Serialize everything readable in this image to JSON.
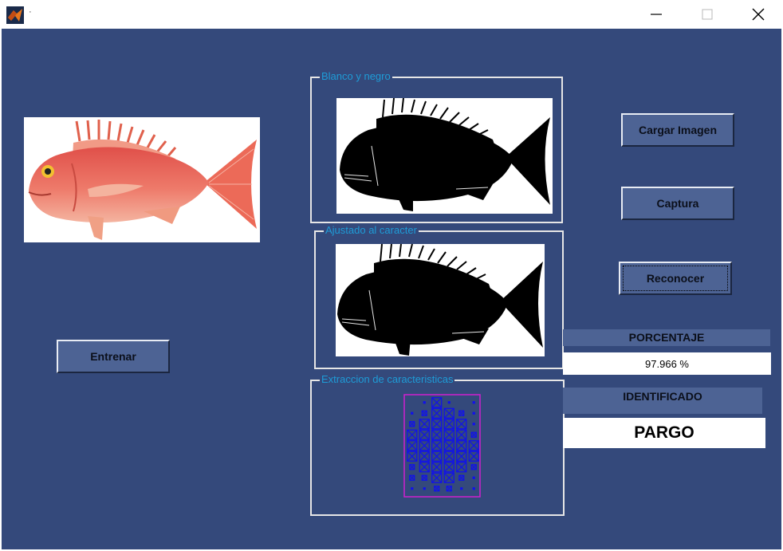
{
  "window": {
    "title": "·",
    "minimize_icon": "minimize-icon",
    "maximize_icon": "maximize-icon",
    "close_icon": "close-icon"
  },
  "colors": {
    "background": "#34497b",
    "button": "#4d6394",
    "frame_title": "#1e9cd7",
    "feature_grid": "#1010ee",
    "feature_border": "#d020d0"
  },
  "panels": {
    "bw_title": "Blanco y negro",
    "adjusted_title": "Ajustado al caracter",
    "features_title": "Extraccion de caracteristicas"
  },
  "buttons": {
    "load": "Cargar Imagen",
    "capture": "Captura",
    "recognize": "Reconocer",
    "train": "Entrenar"
  },
  "results": {
    "percentage_label": "PORCENTAJE",
    "percentage_value": "97.966 %",
    "identified_label": "IDENTIFICADO",
    "identified_value": "PARGO"
  }
}
